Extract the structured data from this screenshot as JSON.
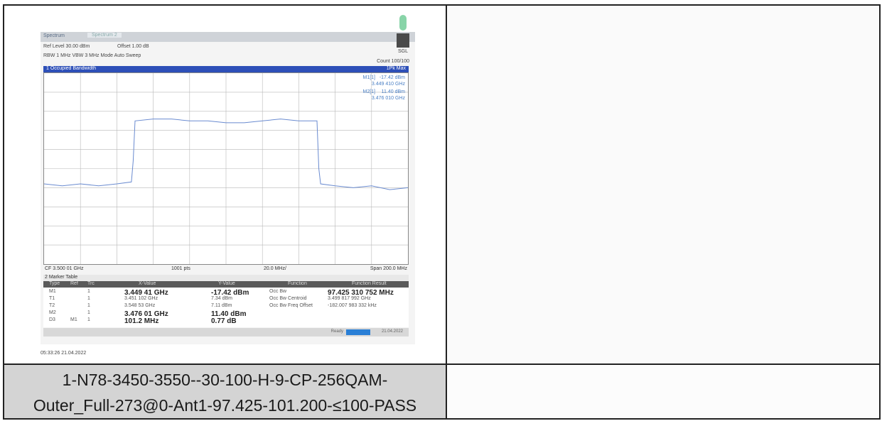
{
  "caption": {
    "line1": "1-N78-3450-3550--30-100-H-9-CP-256QAM-",
    "line2": "Outer_Full-273@0-Ant1-97.425-101.200-≤100-PASS"
  },
  "analyzer": {
    "ref_level": "Ref Level 30.00 dBm",
    "offset": "Offset 1.00 dB",
    "sgl": "SGL",
    "rbw_line": "RBW 1 MHz  VBW 3 MHz  Mode Auto Sweep",
    "count": "Count 100/100",
    "window_title": "1 Occupied Bandwidth",
    "trace_mode": "1Pk Max",
    "m1_label": "M1[1]",
    "m1_value": "-17.42 dBm",
    "m1_freq": "3.449 410 GHz",
    "m2_label": "M2[1]",
    "m2_value": "11.40 dBm",
    "m2_freq": "3.476 010 GHz",
    "center": "CF 3.500 01 GHz",
    "points": "1001 pts",
    "per_div": "20.0 MHz/",
    "span": "Span 200.0 MHz",
    "timestamp": "05:33:26  21.04.2022"
  },
  "marker_table": {
    "title": "2 Marker Table",
    "headers": [
      "Type",
      "Ref",
      "Trc",
      "X-Value",
      "Y-Value",
      "Function",
      "Function Result"
    ],
    "rows": [
      {
        "type": "M1",
        "ref": "",
        "trc": "1",
        "x": "3.449 41 GHz",
        "y": "-17.42 dBm",
        "func": "Occ Bw",
        "result": "97.425 310 752 MHz"
      },
      {
        "type": "T1",
        "ref": "",
        "trc": "1",
        "x": "3.451 102 GHz",
        "y": "7.34 dBm",
        "func": "Occ Bw Centroid",
        "result": "3.499 817 992 GHz"
      },
      {
        "type": "T2",
        "ref": "",
        "trc": "1",
        "x": "3.548 53 GHz",
        "y": "7.11 dBm",
        "func": "Occ Bw Freq Offset",
        "result": "-182.007 983 332 kHz"
      },
      {
        "type": "M2",
        "ref": "",
        "trc": "1",
        "x": "3.476 01 GHz",
        "y": "11.40 dBm",
        "func": "",
        "result": ""
      },
      {
        "type": "D3",
        "ref": "M1",
        "trc": "1",
        "x": "101.2 MHz",
        "y": "0.77 dB",
        "func": "",
        "result": ""
      }
    ]
  },
  "chart_data": {
    "type": "line",
    "xlabel": "",
    "ylabel": "",
    "x_unit": "MHz offset",
    "xlim": [
      -100,
      100
    ],
    "ylim": [
      -70,
      30
    ],
    "grid": true,
    "series": [
      {
        "name": "1Pk Max",
        "color": "#6a8bd0",
        "x": [
          -100,
          -90,
          -80,
          -70,
          -60,
          -52,
          -51,
          -50,
          -40,
          -30,
          -20,
          -10,
          0,
          10,
          20,
          30,
          40,
          50,
          51,
          52,
          60,
          70,
          80,
          90,
          100
        ],
        "y": [
          -28,
          -29,
          -28,
          -29,
          -28,
          -27,
          -16,
          5,
          6,
          6,
          5,
          5,
          4,
          4,
          5,
          6,
          5,
          5,
          -20,
          -28,
          -29,
          -30,
          -29,
          -31,
          -30
        ]
      }
    ],
    "colors": {
      "accent_bar": "#2d4fb8",
      "trace": "#6a8bd0",
      "grid": "#b8b8b8"
    }
  }
}
